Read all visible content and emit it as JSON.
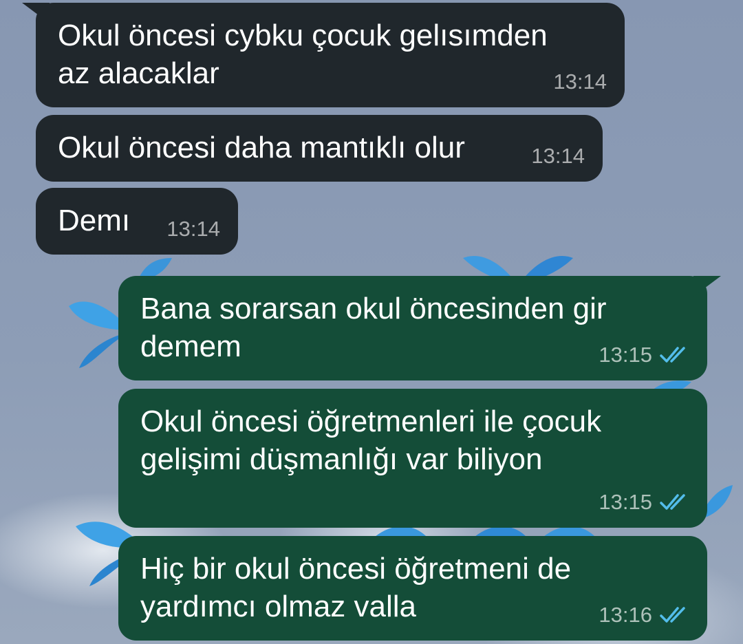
{
  "colors": {
    "incoming_bubble": "#20272c",
    "outgoing_bubble": "#144d38",
    "read_ticks": "#53bdeb",
    "wallpaper": "#8a9bb5"
  },
  "wallpaper": {
    "description_icon": "blue-butterfly-icon"
  },
  "messages": [
    {
      "direction": "incoming",
      "text": "Okul öncesi cybku çocuk gelısımden\naz alacaklar",
      "time": "13:14"
    },
    {
      "direction": "incoming",
      "text": "Okul öncesi daha mantıklı olur",
      "time": "13:14"
    },
    {
      "direction": "incoming",
      "text": "Demı",
      "time": "13:14"
    },
    {
      "direction": "outgoing",
      "text": "Bana sorarsan okul öncesinden gir\ndemem",
      "time": "13:15",
      "status": "read"
    },
    {
      "direction": "outgoing",
      "text": "Okul öncesi öğretmenleri ile çocuk\ngelişimi düşmanlığı var biliyon",
      "time": "13:15",
      "status": "read"
    },
    {
      "direction": "outgoing",
      "text": "Hiç bir okul öncesi öğretmeni de\nyardımcı olmaz valla",
      "time": "13:16",
      "status": "read"
    }
  ]
}
